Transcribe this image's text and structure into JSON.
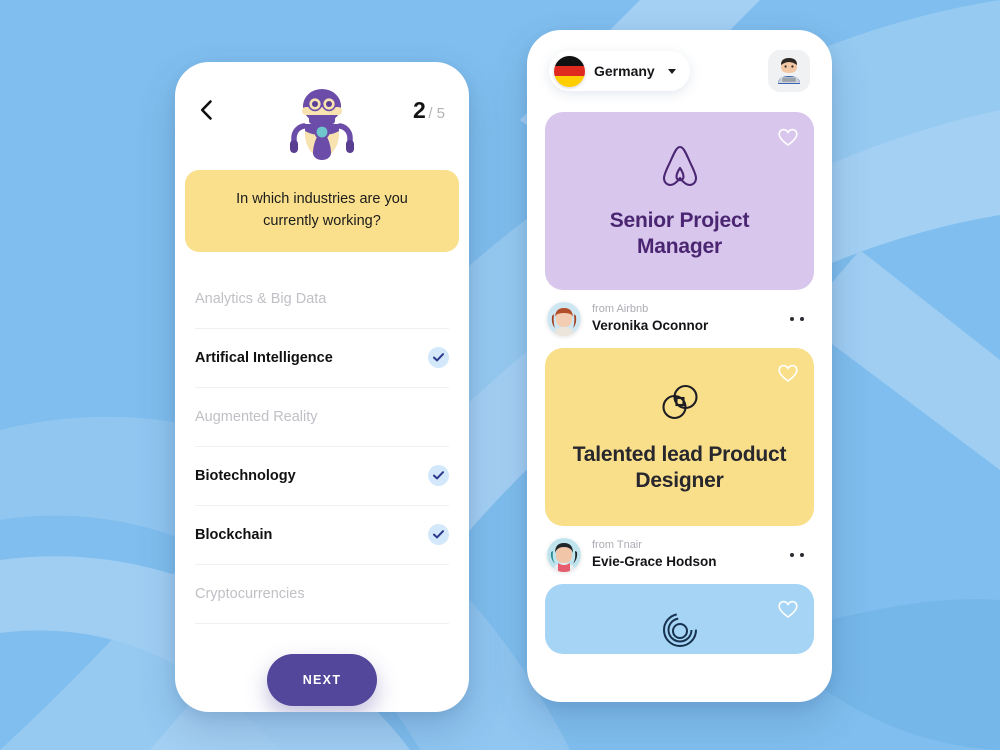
{
  "theme": {
    "background": "#7FBEEE",
    "wave_light": "#A6D2F4",
    "wave_lighter": "#BFDEF8",
    "accent_purple": "#53479B",
    "banner_yellow": "#FAE08C",
    "check_bg": "#D3E8FA",
    "check_tick": "#2B3A8C"
  },
  "onboarding": {
    "back_icon": "chevron-left-icon",
    "mascot_icon": "robot-mascot",
    "step_current": "2",
    "step_total": "/ 5",
    "question": "In which industries are you currently working?",
    "options": [
      {
        "label": "Analytics & Big Data",
        "selected": false
      },
      {
        "label": "Artifical Intelligence",
        "selected": true
      },
      {
        "label": "Augmented Reality",
        "selected": false
      },
      {
        "label": "Biotechnology",
        "selected": true
      },
      {
        "label": "Blockchain",
        "selected": true
      },
      {
        "label": "Cryptocurrencies",
        "selected": false
      }
    ],
    "next_label": "NEXT"
  },
  "feed": {
    "country": {
      "name": "Germany",
      "flag_icon": "germany-flag-icon",
      "caret_icon": "chevron-down-icon"
    },
    "avatar_icon": "user-avatar-technologist",
    "cards": [
      {
        "title": "Senior Project Manager",
        "bg": "#D8C6EC",
        "text_color": "#4A2672",
        "logo_icon": "airbnb-logo",
        "favorite_icon": "heart-outline-icon",
        "author": {
          "from": "from Airbnb",
          "name": "Veronika Oconnor",
          "avatar_icon": "woman-avatar",
          "menu_icon": "more-dots-icon"
        }
      },
      {
        "title": "Talented lead Product Designer",
        "bg": "#FADF8A",
        "text_color": "#27272D",
        "logo_icon": "tnair-logo",
        "favorite_icon": "heart-outline-icon",
        "author": {
          "from": "from Tnair",
          "name": "Evie-Grace Hodson",
          "avatar_icon": "woman-avatar-2",
          "menu_icon": "more-dots-icon"
        }
      },
      {
        "title": "",
        "bg": "#A6D4F5",
        "text_color": "#16324E",
        "logo_icon": "circle-spiral-logo",
        "favorite_icon": "heart-outline-icon",
        "author": null
      }
    ]
  }
}
